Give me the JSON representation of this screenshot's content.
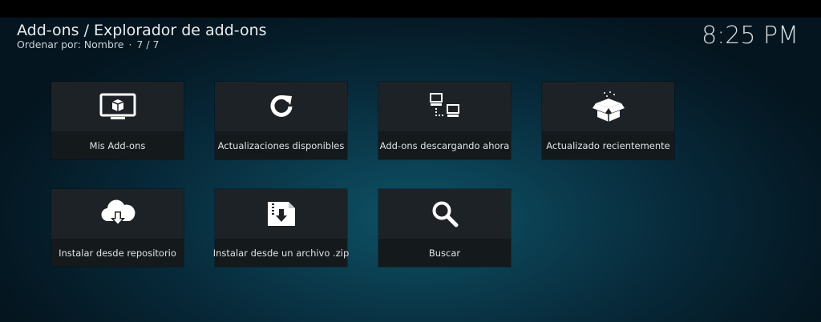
{
  "header": {
    "breadcrumb": "Add-ons / Explorador de add-ons",
    "sort_label": "Ordenar por: Nombre",
    "item_count": "7 / 7",
    "clock": "8:25 PM"
  },
  "tiles": [
    {
      "label": "Mis Add-ons",
      "icon": "tv-box-icon"
    },
    {
      "label": "Actualizaciones disponibles",
      "icon": "refresh-icon"
    },
    {
      "label": "Add-ons descargando ahora",
      "icon": "network-download-icon"
    },
    {
      "label": "Actualizado recientemente",
      "icon": "open-box-icon"
    },
    {
      "label": "Instalar desde repositorio",
      "icon": "cloud-download-icon"
    },
    {
      "label": "Instalar desde un archivo .zip",
      "icon": "zip-file-icon"
    },
    {
      "label": "Buscar",
      "icon": "search-icon"
    }
  ],
  "colors": {
    "tile_bg": "#1c2226",
    "label_bg": "#14191c",
    "text": "#dfe3e5",
    "icon": "#ffffff"
  }
}
